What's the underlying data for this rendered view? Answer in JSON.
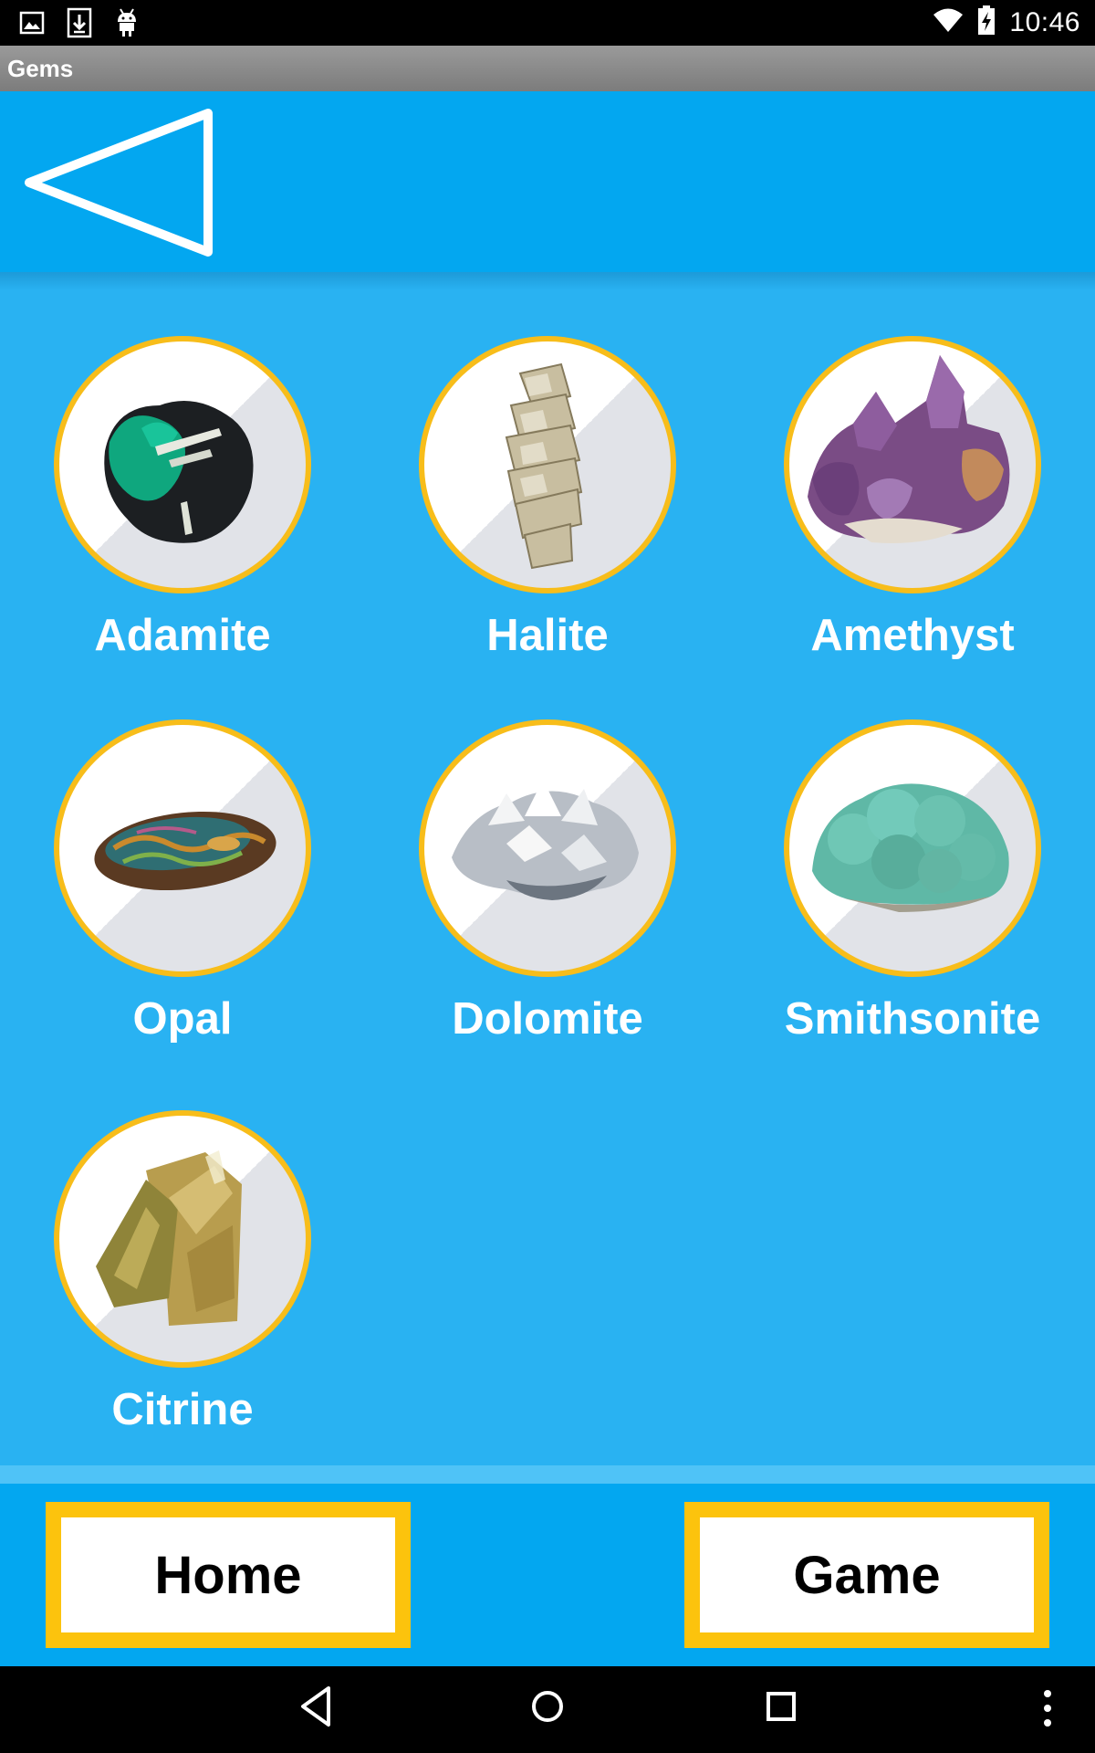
{
  "status_bar": {
    "time": "10:46",
    "icons": [
      "image-icon",
      "download-icon",
      "android-icon",
      "wifi-icon",
      "battery-charging-icon"
    ]
  },
  "window": {
    "title": "Gems"
  },
  "header": {
    "back_icon": "triangle-back-icon"
  },
  "gems": [
    {
      "name": "Adamite",
      "image": "adamite-image"
    },
    {
      "name": "Halite",
      "image": "halite-image"
    },
    {
      "name": "Amethyst",
      "image": "amethyst-image"
    },
    {
      "name": "Opal",
      "image": "opal-image"
    },
    {
      "name": "Dolomite",
      "image": "dolomite-image"
    },
    {
      "name": "Smithsonite",
      "image": "smithsonite-image"
    },
    {
      "name": "Citrine",
      "image": "citrine-image"
    }
  ],
  "footer": {
    "home_label": "Home",
    "game_label": "Game"
  },
  "colors": {
    "app_background": "#29b2f2",
    "bar_background": "#03a7f0",
    "accent_border": "#f7bd1a",
    "button_border": "#fcc30d"
  },
  "system_nav": [
    "back-icon",
    "home-icon",
    "recents-icon",
    "menu-icon"
  ]
}
